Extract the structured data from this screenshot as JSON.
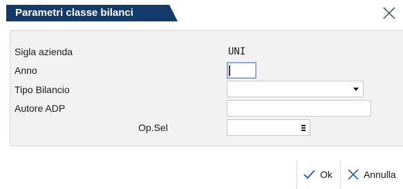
{
  "window": {
    "title": "Parametri classe bilanci"
  },
  "form": {
    "sigla_azienda_label": "Sigla azienda",
    "sigla_azienda_value": "UNI",
    "anno_label": "Anno",
    "anno_value": "",
    "tipo_bilancio_label": "Tipo Bilancio",
    "tipo_bilancio_value": "",
    "autore_adp_label": "Autore ADP",
    "autore_adp_value": "",
    "op_sel_label": "Op.Sel",
    "op_sel_value": ""
  },
  "footer": {
    "ok_label": "Ok",
    "annulla_label": "Annulla"
  },
  "icons": {
    "close": "close-icon",
    "ok": "check-icon",
    "annulla": "x-icon",
    "dropdown": "chevron-down-icon",
    "menu": "menu-icon"
  },
  "colors": {
    "title_bg": "#123a6b",
    "panel_bg": "#f2f2f2",
    "accent_icon": "#2f5fa8"
  }
}
